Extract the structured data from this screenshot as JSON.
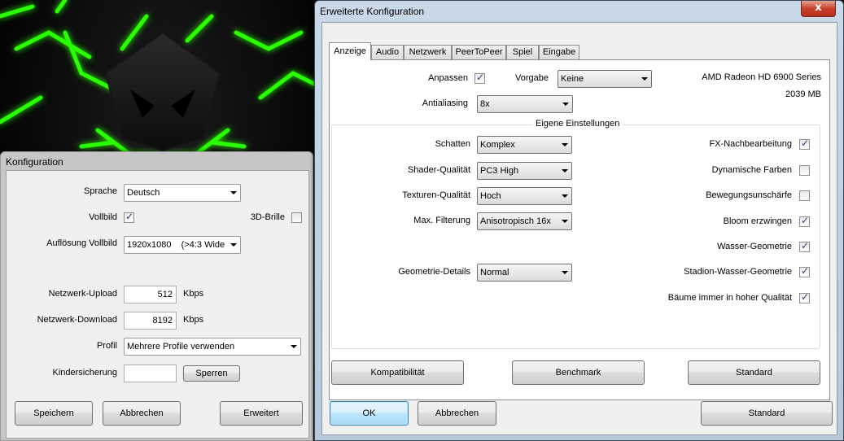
{
  "colors": {
    "glow": "#33ff00",
    "close": "#c8402c"
  },
  "konfig": {
    "title": "Konfiguration",
    "sprache_label": "Sprache",
    "sprache_value": "Deutsch",
    "vollbild_label": "Vollbild",
    "vollbild_checked": true,
    "brille_label": "3D-Brille",
    "brille_checked": false,
    "aufloesung_label": "Auflösung Vollbild",
    "aufloesung_value": "1920x1080    (>4:3 Wide",
    "upload_label": "Netzwerk-Upload",
    "upload_value": "512",
    "upload_unit": "Kbps",
    "download_label": "Netzwerk-Download",
    "download_value": "8192",
    "download_unit": "Kbps",
    "profil_label": "Profil",
    "profil_value": "Mehrere Profile verwenden",
    "kinder_label": "Kindersicherung",
    "kinder_value": "",
    "sperren_label": "Sperren",
    "speichern_label": "Speichern",
    "abbrechen_label": "Abbrechen",
    "erweitert_label": "Erweitert"
  },
  "erw": {
    "title": "Erweiterte Konfiguration",
    "close_glyph": "x",
    "tabs": [
      "Anzeige",
      "Audio",
      "Netzwerk",
      "PeerToPeer",
      "Spiel",
      "Eingabe"
    ],
    "anpassen_label": "Anpassen",
    "anpassen_checked": true,
    "vorgabe_label": "Vorgabe",
    "vorgabe_value": "Keine",
    "gpu_name": "AMD Radeon HD 6900 Series",
    "gpu_memory": "2039 MB",
    "antialiasing_label": "Antialiasing",
    "antialiasing_value": "8x",
    "group_title": "Eigene Einstellungen",
    "settings": [
      {
        "label": "Schatten",
        "value": "Komplex"
      },
      {
        "label": "Shader-Qualität",
        "value": "PC3 High"
      },
      {
        "label": "Texturen-Qualität",
        "value": "Hoch"
      },
      {
        "label": "Max. Filterung",
        "value": "Anisotropisch 16x"
      },
      {
        "label": "Geometrie-Details",
        "value": "Normal"
      }
    ],
    "checks": [
      {
        "label": "FX-Nachbearbeitung",
        "checked": true
      },
      {
        "label": "Dynamische Farben",
        "checked": false
      },
      {
        "label": "Bewegungsunschärfe",
        "checked": false
      },
      {
        "label": "Bloom erzwingen",
        "checked": true
      },
      {
        "label": "Wasser-Geometrie",
        "checked": true
      },
      {
        "label": "Stadion-Wasser-Geometrie",
        "checked": true
      },
      {
        "label": "Bäume immer in hoher Qualität",
        "checked": true
      }
    ],
    "kompat_label": "Kompatibilität",
    "benchmark_label": "Benchmark",
    "standard_inner_label": "Standard",
    "ok_label": "OK",
    "abbrechen_label": "Abbrechen",
    "standard_label": "Standard",
    "check_glyph": "✓"
  }
}
